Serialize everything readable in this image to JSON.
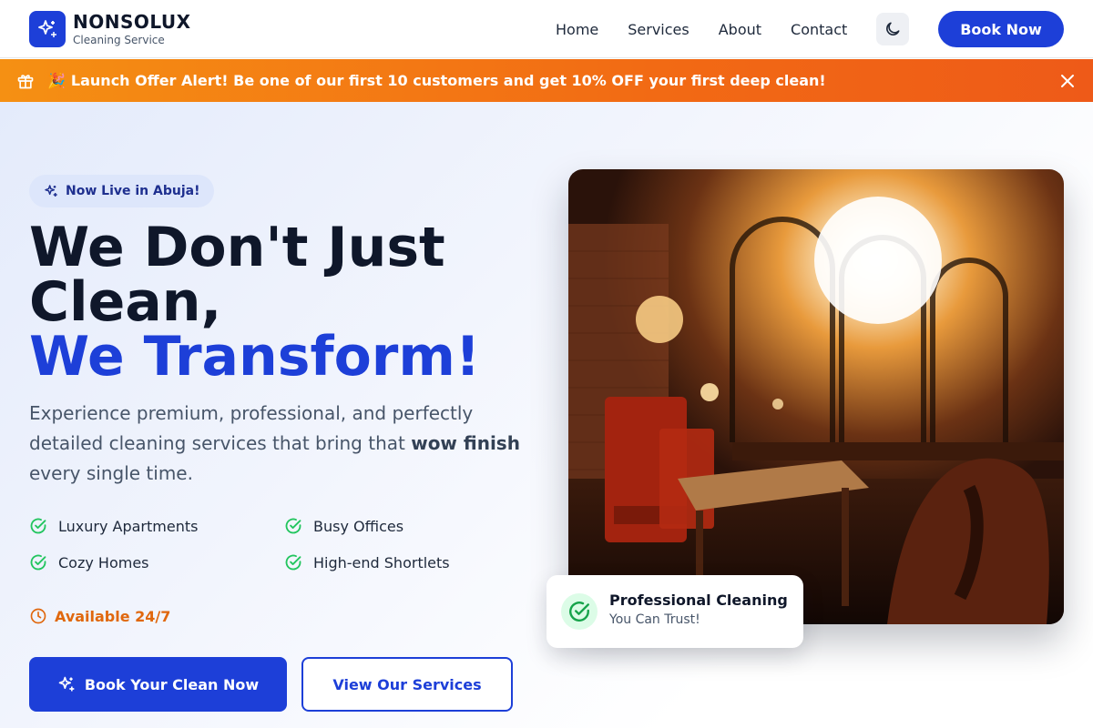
{
  "header": {
    "brand_name": "NONSOLUX",
    "brand_sub": "Cleaning Service",
    "logo_icon": "sparkles-icon",
    "nav": [
      "Home",
      "Services",
      "About",
      "Contact"
    ],
    "theme_icon": "moon-icon",
    "book_label": "Book Now"
  },
  "banner": {
    "icon": "gift-icon",
    "emoji": "🎉",
    "text": "Launch Offer Alert! Be one of our first 10 customers and get 10% OFF your first deep clean!",
    "close_icon": "close-icon"
  },
  "hero": {
    "pill": "Now Live in Abuja!",
    "headline_1": "We Don't Just",
    "headline_2": "Clean,",
    "headline_3": "We Transform!",
    "desc_pre": "Experience premium, professional, and perfectly detailed cleaning services that bring that ",
    "desc_bold": "wow finish",
    "desc_post": " every single time.",
    "features": [
      "Luxury Apartments",
      "Busy Offices",
      "Cozy Homes",
      "High-end Shortlets"
    ],
    "availability": "Available 24/7",
    "cta_primary": "Book Your Clean Now",
    "cta_secondary": "View Our Services"
  },
  "badge": {
    "title": "Professional Cleaning",
    "subtitle": "You Can Trust!",
    "icon": "check-circle-icon"
  },
  "colors": {
    "primary": "#1d3fd8",
    "accent_orange": "#f26a14",
    "success": "#22c55e"
  }
}
